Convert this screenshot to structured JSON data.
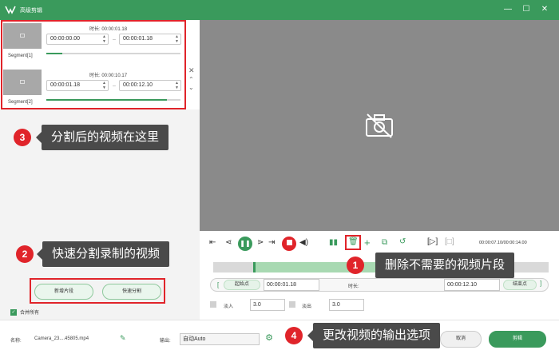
{
  "window": {
    "title": "高级剪辑"
  },
  "segments": [
    {
      "label": "Segment[1]",
      "duration": "时长: 00:00:01.18",
      "start": "00:00:00.00",
      "end": "00:00:01.18",
      "progress": 0.12
    },
    {
      "label": "Segment[2]",
      "duration": "时长: 00:00:10.17",
      "start": "00:00:01.18",
      "end": "00:00:12.10",
      "progress": 0.9
    }
  ],
  "left_buttons": {
    "new_segment": "新增片段",
    "quick_split": "快速分割"
  },
  "merge_all": "合并所有",
  "player": {
    "timecode": "00:00:07.10/00:00:14.00"
  },
  "trim": {
    "start_label": "起始点",
    "start_value": "00:00:01.18",
    "duration_label": "时长:",
    "end_value": "00:00:12.10",
    "end_label": "结束点",
    "fade_in_label": "淡入",
    "fade_in_value": "3.0",
    "fade_out_label": "淡出",
    "fade_out_value": "3.0"
  },
  "bottom": {
    "name_label": "名称:",
    "filename": "Camera_23....45805.mp4",
    "output_label": "输出:",
    "output_value": "自动Auto",
    "cancel_label": "取消",
    "export_label": "剪辑"
  },
  "callouts": [
    {
      "num": "1",
      "text": "删除不需要的视频片段"
    },
    {
      "num": "2",
      "text": "快速分割录制的视频"
    },
    {
      "num": "3",
      "text": "分割后的视频在这里"
    },
    {
      "num": "4",
      "text": "更改视频的输出选项"
    }
  ],
  "colors": {
    "accent": "#3a9a5c",
    "annotation": "#e0242a",
    "callout_bg": "#4a4a4a"
  }
}
